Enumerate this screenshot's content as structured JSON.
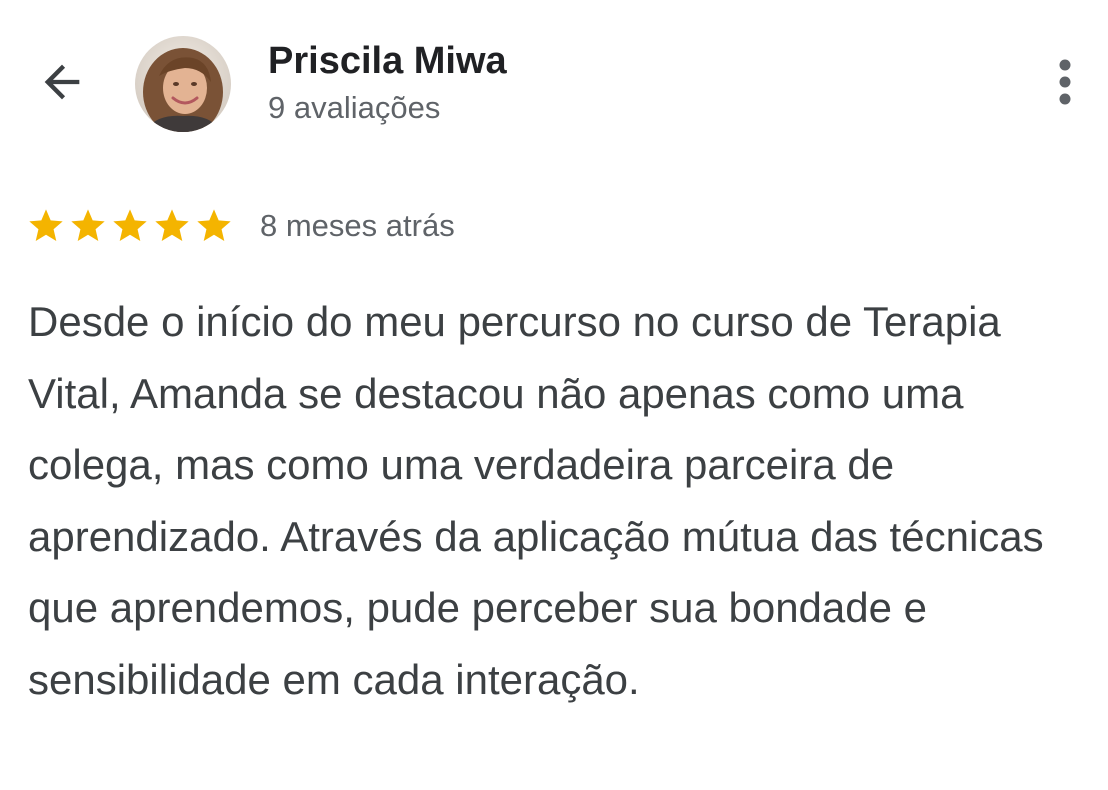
{
  "header": {
    "back_icon": "arrow-back-icon",
    "avatar_icon": "profile-photo",
    "name": "Priscila Miwa",
    "review_count": "9 avaliações",
    "more_icon": "more-vertical-icon"
  },
  "review": {
    "rating": 5,
    "rating_max": 5,
    "star_color": "#f4b400",
    "time": "8 meses atrás",
    "text": "Desde o início do meu percurso no curso de Terapia Vital, Amanda se destacou não apenas como uma colega, mas como uma verdadeira parceira de aprendizado. Através da aplicação mútua das técnicas que aprendemos, pude perceber sua bondade e sensibilidade em cada interação."
  }
}
